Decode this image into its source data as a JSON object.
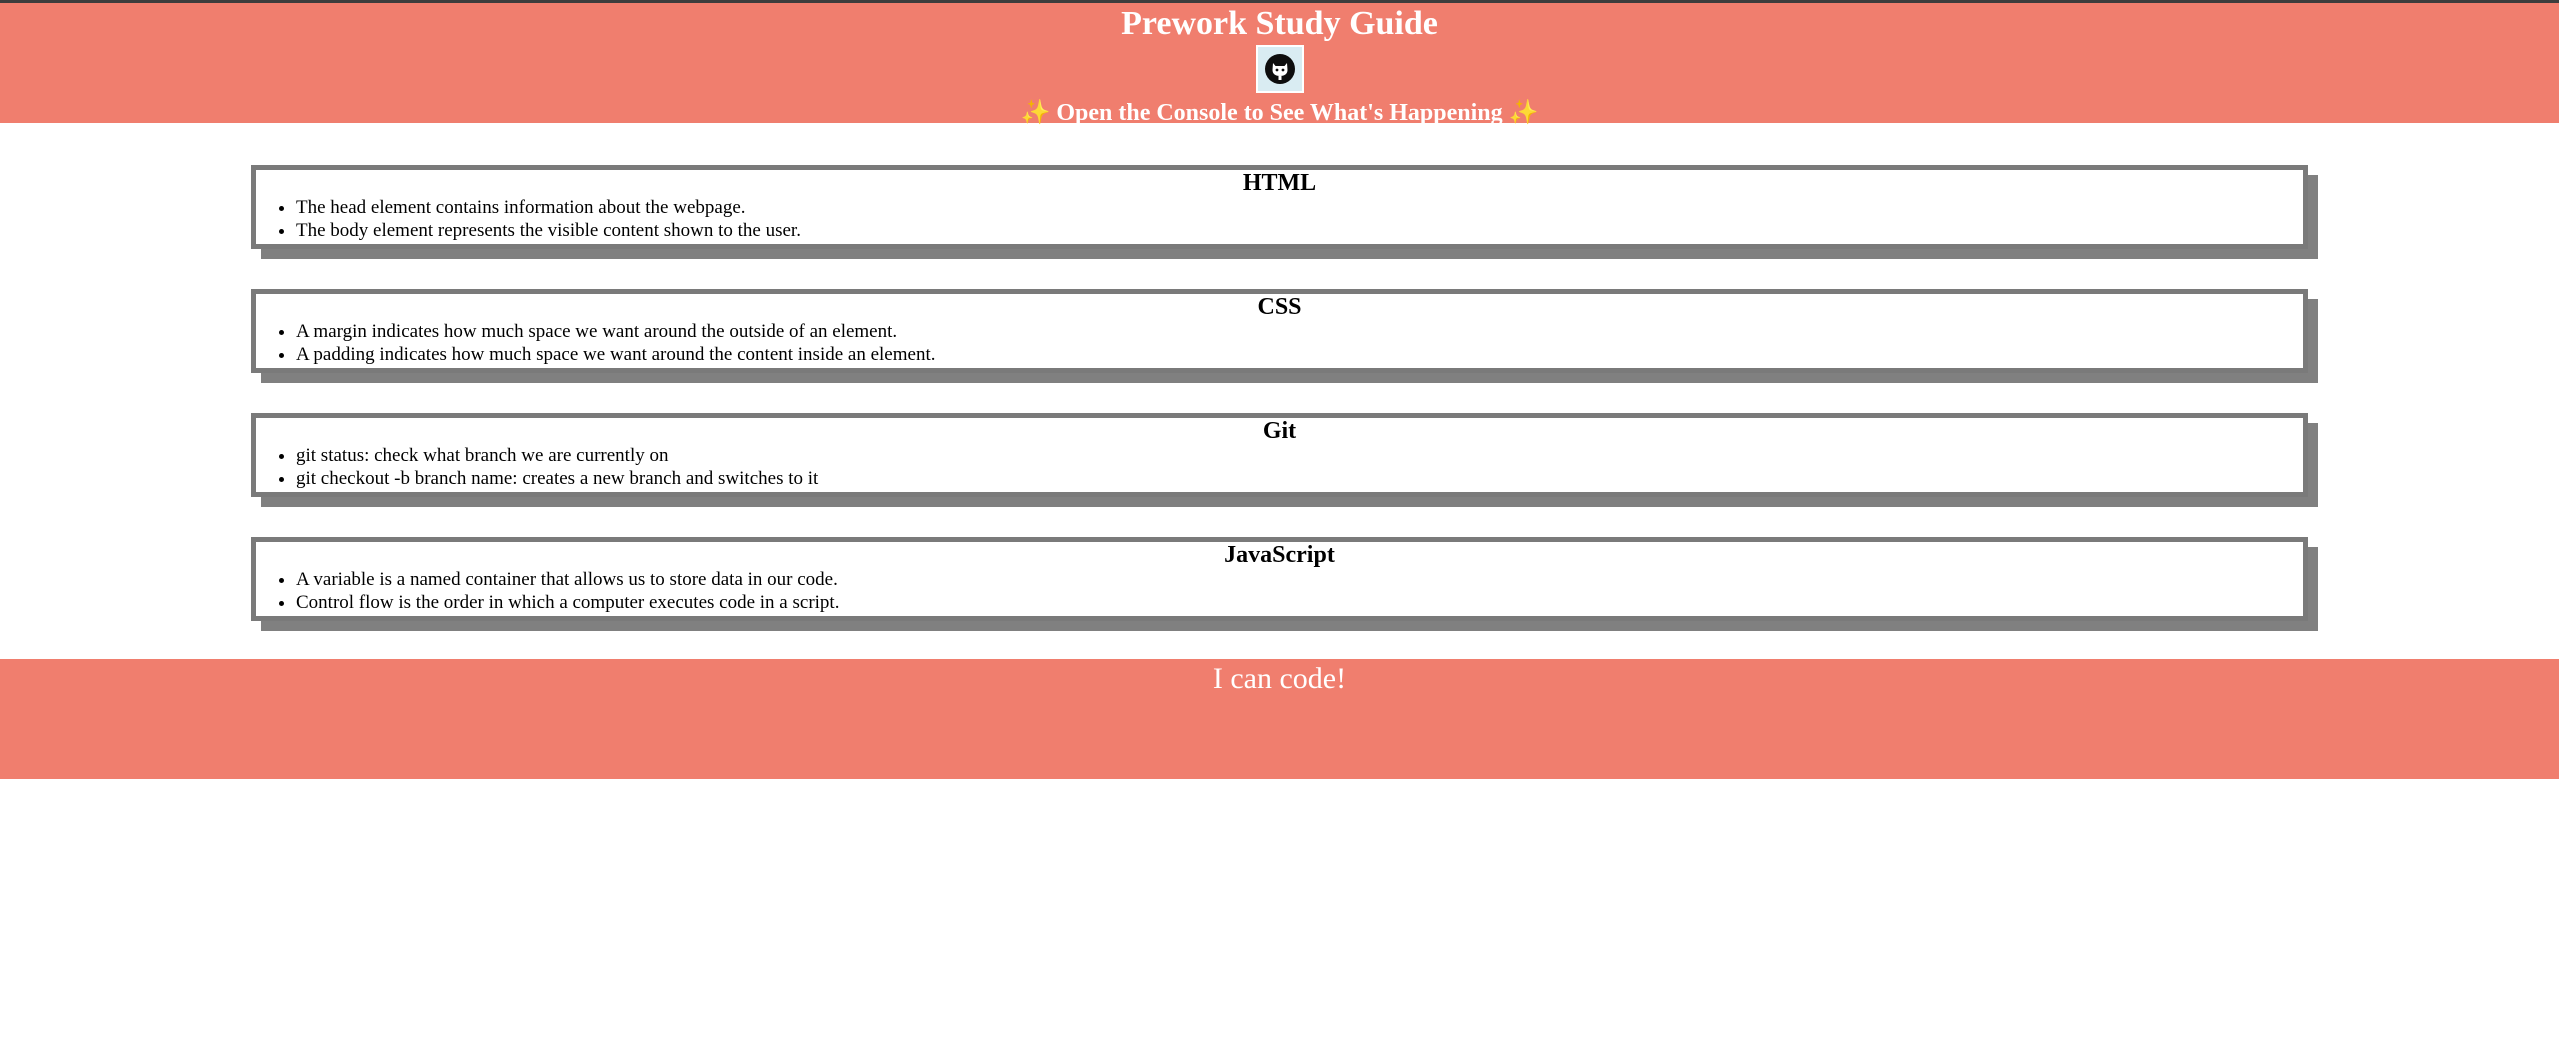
{
  "header": {
    "title": "Prework Study Guide",
    "logo_icon": "github-octocat-icon",
    "subtitle_sparkle_left": "✨",
    "subtitle_text": " Open the Console to See What's Happening ",
    "subtitle_sparkle_right": "✨"
  },
  "cards": [
    {
      "heading": "HTML",
      "items": [
        "The head element contains information about the webpage.",
        "The body element represents the visible content shown to the user."
      ]
    },
    {
      "heading": "CSS",
      "items": [
        "A margin indicates how much space we want around the outside of an element.",
        "A padding indicates how much space we want around the content inside an element."
      ]
    },
    {
      "heading": "Git",
      "items": [
        "git status: check what branch we are currently on",
        "git checkout -b branch name: creates a new branch and switches to it"
      ]
    },
    {
      "heading": "JavaScript",
      "items": [
        "A variable is a named container that allows us to store data in our code.",
        "Control flow is the order in which a computer executes code in a script."
      ]
    }
  ],
  "footer": {
    "text": "I can code!"
  },
  "colors": {
    "header_bg": "#f07e6e",
    "card_border": "#7a7a7a",
    "card_shadow": "#808080"
  }
}
